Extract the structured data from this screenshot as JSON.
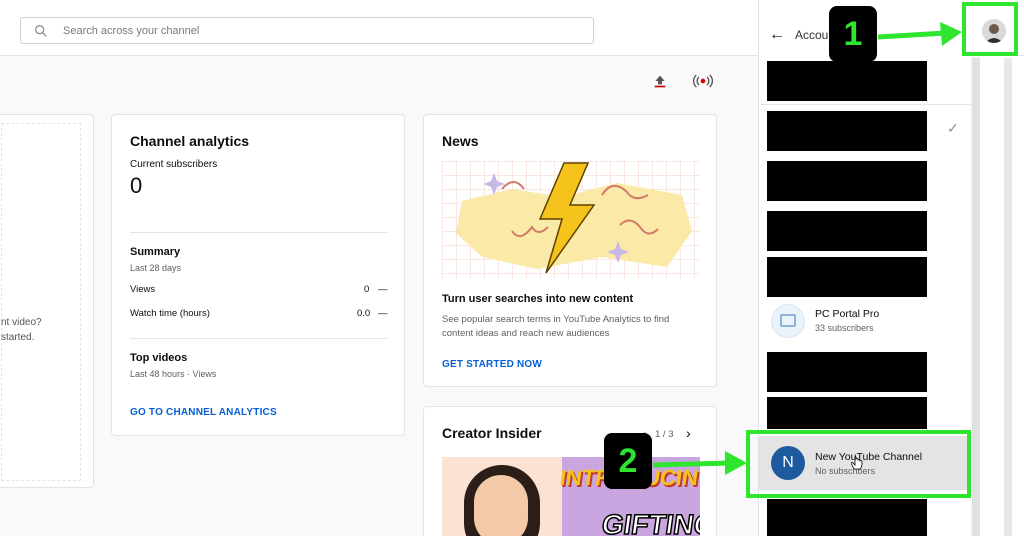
{
  "search": {
    "placeholder": "Search across your channel"
  },
  "header": {
    "upload_icon": "upload-icon",
    "live_icon": "live-icon"
  },
  "left_card": {
    "line1": "nt video?",
    "line2": " started."
  },
  "analytics": {
    "title": "Channel analytics",
    "subs_label": "Current subscribers",
    "subs_value": "0",
    "summary_title": "Summary",
    "summary_period": "Last 28 days",
    "views_label": "Views",
    "views_value": "0",
    "views_trend": "—",
    "watch_label": "Watch time (hours)",
    "watch_value": "0.0",
    "watch_trend": "—",
    "top_title": "Top videos",
    "top_period": "Last 48 hours · Views",
    "link": "GO TO CHANNEL ANALYTICS"
  },
  "news": {
    "title": "News",
    "headline": "Turn user searches into new content",
    "body": "See popular search terms in YouTube Analytics to find content ideas and reach new audiences",
    "link": "GET STARTED NOW"
  },
  "insider": {
    "title": "Creator Insider",
    "pager": "1 / 3",
    "thumb_text1": "INTRODUCING",
    "thumb_text2": "GIFTING"
  },
  "accounts": {
    "header": "Accou",
    "items": [
      {
        "name": "PC Portal Pro",
        "subs": "33 subscribers"
      },
      {
        "name": "New YouTube Channel",
        "subs": "No subscribers",
        "initial": "N"
      }
    ]
  },
  "annotations": {
    "step1": "1",
    "step2": "2",
    "color": "#2ee62e"
  },
  "colors": {
    "link": "#065fd4",
    "avatar_n": "#1e5aa0",
    "bolt": "#f6c21c"
  }
}
